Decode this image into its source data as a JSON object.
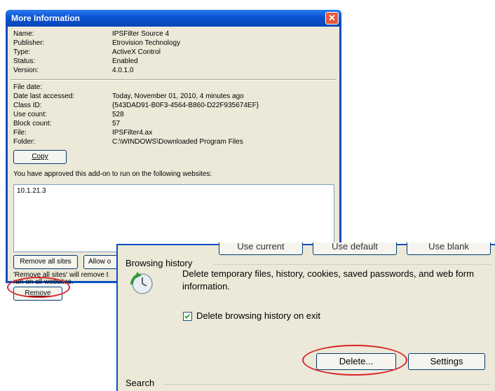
{
  "more_info_dialog": {
    "title": "More Information",
    "close_glyph": "✕",
    "properties": [
      {
        "label": "Name:",
        "value": "IPSFilter Source 4"
      },
      {
        "label": "Publisher:",
        "value": "Etrovision Technology"
      },
      {
        "label": "Type:",
        "value": "ActiveX Control"
      },
      {
        "label": "Status:",
        "value": "Enabled"
      },
      {
        "label": "Version:",
        "value": "4.0.1.0"
      }
    ],
    "details": [
      {
        "label": "File date:",
        "value": ""
      },
      {
        "label": "Date last accessed:",
        "value": "Today, November 01, 2010, 4 minutes ago"
      },
      {
        "label": "Class ID:",
        "value": "{543DAD91-B0F3-4564-B860-D22F935674EF}"
      },
      {
        "label": "Use count:",
        "value": "528"
      },
      {
        "label": "Block count:",
        "value": "57"
      },
      {
        "label": "File:",
        "value": "IPSFilter4.ax"
      },
      {
        "label": "Folder:",
        "value": "C:\\WINDOWS\\Downloaded Program Files"
      }
    ],
    "copy_label": "Copy",
    "approved_text": "You have approved this add-on to run on the following websites:",
    "approved_sites": [
      "10.1.21.3"
    ],
    "remove_all_label": "Remove all sites",
    "allow_label": "Allow o",
    "note_line1": "'Remove all sites' will remove t",
    "note_line2": "run on all websites.",
    "remove_label": "Remove"
  },
  "internet_options": {
    "top_buttons": [
      "Use current",
      "Use default",
      "Use blank"
    ],
    "browsing_history_title": "Browsing history",
    "description": "Delete temporary files, history, cookies, saved passwords, and web form information.",
    "delete_on_exit_label": "Delete browsing history on exit",
    "delete_on_exit_checked": true,
    "delete_label": "Delete...",
    "settings_label": "Settings",
    "search_title": "Search"
  },
  "colors": {
    "highlight_oval": "#d9252a",
    "xp_title_blue": "#0a4ec6",
    "dialog_face": "#ece9d8"
  }
}
